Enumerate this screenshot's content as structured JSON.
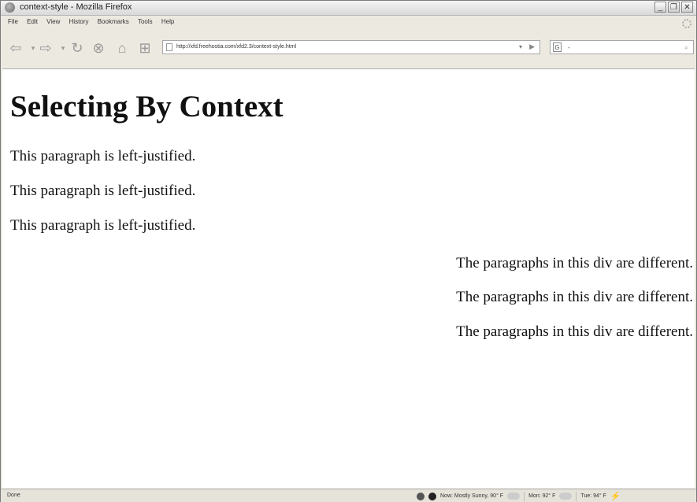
{
  "window": {
    "title": "context-style - Mozilla Firefox"
  },
  "menu": [
    "File",
    "Edit",
    "View",
    "History",
    "Bookmarks",
    "Tools",
    "Help"
  ],
  "navbar": {
    "url": "http://xfd.freehostia.com/xfd2.3/context-style.html",
    "search_value": "-",
    "search_engine": "G"
  },
  "page": {
    "heading": "Selecting By Context",
    "left_paragraphs": [
      "This paragraph is left-justified.",
      "This paragraph is left-justified.",
      "This paragraph is left-justified."
    ],
    "div_paragraphs": [
      "The paragraphs in this div are different.",
      "The paragraphs in this div are different.",
      "The paragraphs in this div are different."
    ]
  },
  "status": {
    "text": "Done",
    "weather_now": "Now: Mostly Sunny, 90° F",
    "weather_mon": "Mon: 92° F",
    "weather_tue": "Tue: 94° F"
  }
}
